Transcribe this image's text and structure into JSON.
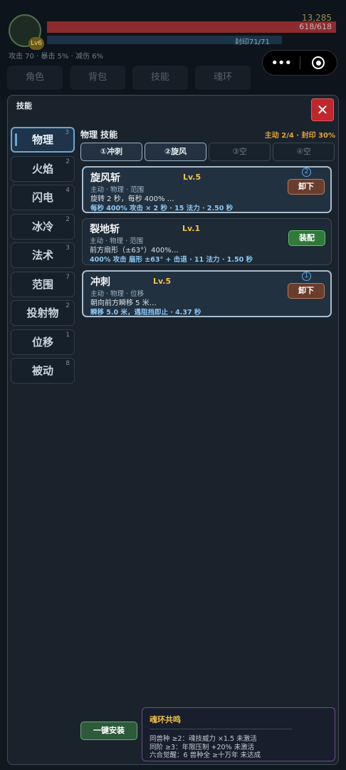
{
  "hud": {
    "gold": "13,285",
    "hp": "618/618",
    "seal": "封印71/71",
    "stats": "攻击 70 · 暴击 5% · 减伤 6%",
    "avatar_level": "Lv6"
  },
  "top_tabs": [
    "角色",
    "背包",
    "技能",
    "魂环"
  ],
  "panel": {
    "title": "技能",
    "close_label": "✕"
  },
  "categories": [
    {
      "label": "物理",
      "count": "3"
    },
    {
      "label": "火焰",
      "count": "2"
    },
    {
      "label": "闪电",
      "count": "4"
    },
    {
      "label": "冰冷",
      "count": "2"
    },
    {
      "label": "法术",
      "count": "3"
    },
    {
      "label": "范围",
      "count": "7"
    },
    {
      "label": "投射物",
      "count": "2"
    },
    {
      "label": "位移",
      "count": "1"
    },
    {
      "label": "被动",
      "count": "8"
    }
  ],
  "main": {
    "title": "物理 技能",
    "status": "主动 2/4 · 封印 30%",
    "slots": [
      "①冲刺",
      "②旋风",
      "③空",
      "④空"
    ]
  },
  "skills": [
    {
      "name": "旋风斩",
      "level": "Lv.5",
      "tags": "主动 · 物理 · 范围",
      "desc": "旋转 2 秒，每秒 400% …",
      "info": "每秒 400% 攻击 × 2 秒 · 15 法力 · 2.50 秒",
      "badge": "2",
      "action": "卸下"
    },
    {
      "name": "裂地斩",
      "level": "Lv.1",
      "tags": "主动 · 物理 · 范围",
      "desc": "前方扇形（±63°）400%…",
      "info": "400% 攻击 扇形 ±63° + 击退 · 11 法力 · 1.50 秒",
      "action": "装配"
    },
    {
      "name": "冲刺",
      "level": "Lv.5",
      "tags": "主动 · 物理 · 位移",
      "desc": "朝向前方瞬移 5 米…",
      "info": "瞬移 5.0 米，遇阻挡即止 · 4.37 秒",
      "badge": "1",
      "action": "卸下"
    }
  ],
  "footer": {
    "oneclick_label": "一键安装",
    "resonance_title": "魂环共鸣",
    "resonance_lines": [
      "同兽种 ≥2：魂技威力 ×1.5  未激活",
      "同阶 ≥3：年限压制 +20%  未激活",
      "六合觉醒：6 兽种全 ≥十万年  未达成"
    ]
  },
  "capsule": {
    "more_icon": "more-dots-icon",
    "close_icon": "target-icon"
  }
}
